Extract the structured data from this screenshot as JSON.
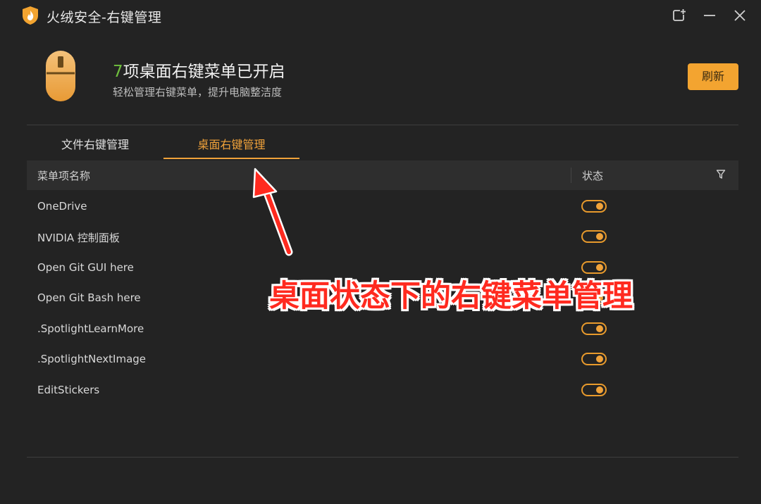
{
  "window": {
    "title": "火绒安全-右键管理"
  },
  "header": {
    "count": "7",
    "title_rest": "项桌面右键菜单已开启",
    "subtitle": "轻松管理右键菜单，提升电脑整洁度",
    "refresh_label": "刷新"
  },
  "tabs": [
    {
      "label": "文件右键管理",
      "active": false
    },
    {
      "label": "桌面右键管理",
      "active": true
    }
  ],
  "table": {
    "col_name": "菜单项名称",
    "col_status": "状态",
    "rows": [
      {
        "name": "OneDrive",
        "enabled": true
      },
      {
        "name": "NVIDIA 控制面板",
        "enabled": true
      },
      {
        "name": "Open Git GUI here",
        "enabled": true
      },
      {
        "name": "Open Git Bash here",
        "enabled": true
      },
      {
        "name": ".SpotlightLearnMore",
        "enabled": true
      },
      {
        "name": ".SpotlightNextImage",
        "enabled": true
      },
      {
        "name": "EditStickers",
        "enabled": true
      }
    ]
  },
  "annotation": {
    "text": "桌面状态下的右键菜单管理"
  },
  "colors": {
    "accent": "#f0a23a",
    "count_green": "#6fbf3d",
    "annotation_red": "#ff2a1f",
    "background": "#232323"
  }
}
